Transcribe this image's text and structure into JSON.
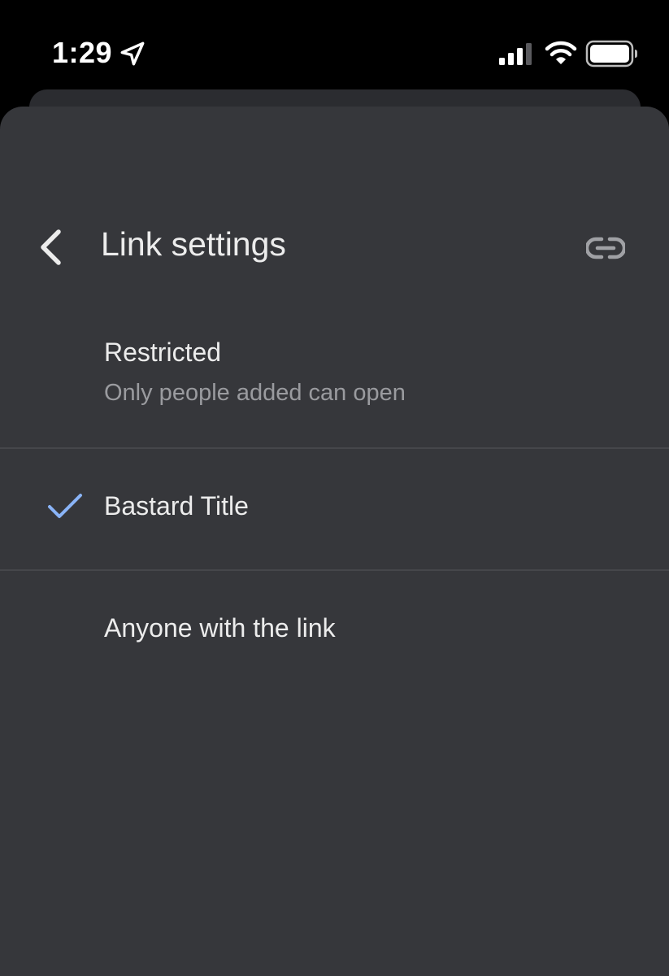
{
  "status_bar": {
    "time": "1:29"
  },
  "header": {
    "title": "Link settings",
    "back_icon": "chevron-left-icon",
    "link_icon": "link-icon"
  },
  "options": [
    {
      "title": "Restricted",
      "subtitle": "Only people added can open",
      "selected": false
    },
    {
      "title": "Bastard Title",
      "selected": true
    },
    {
      "title": "Anyone with the link",
      "selected": false
    }
  ],
  "colors": {
    "sheet_background": "#36373b",
    "check_accent": "#8ab4f8",
    "divider": "#46474b"
  }
}
